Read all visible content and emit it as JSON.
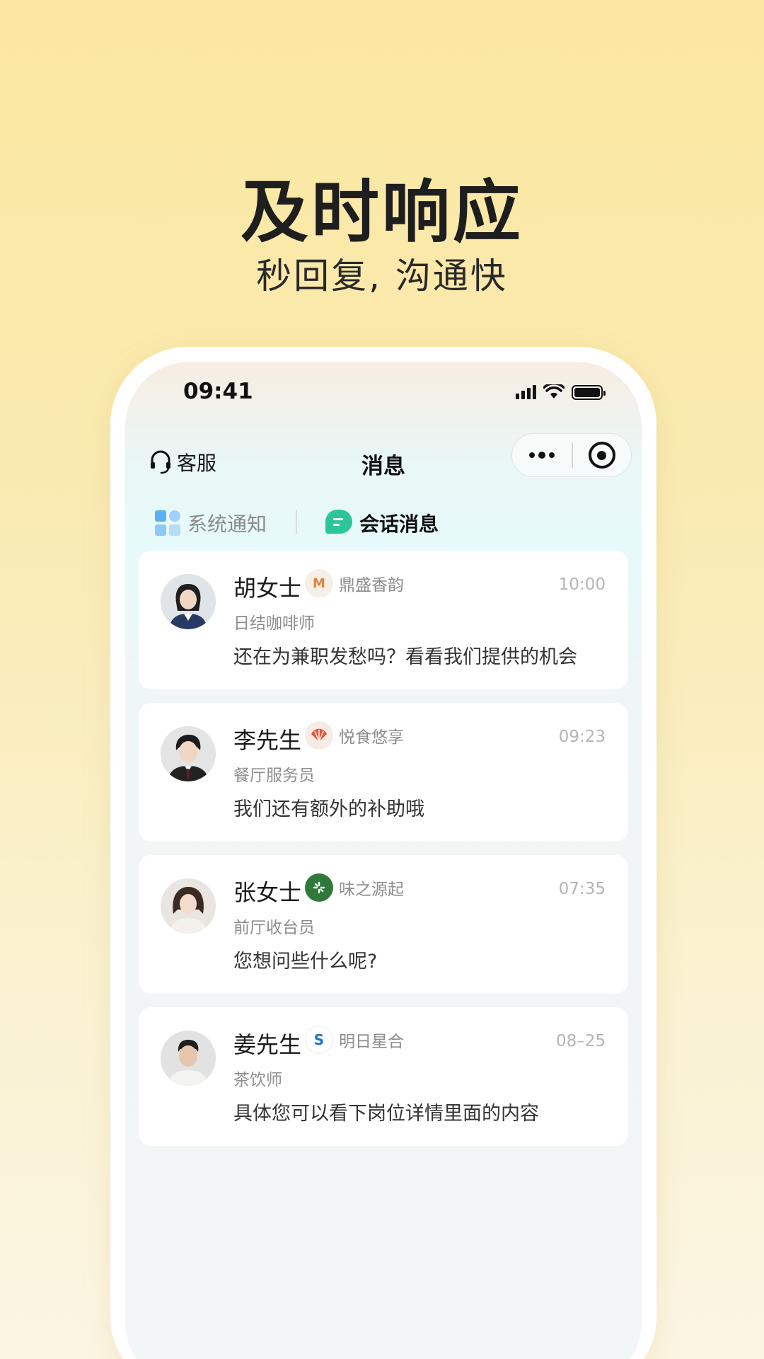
{
  "hero": {
    "title": "及时响应",
    "subtitle": "秒回复, 沟通快"
  },
  "status_bar": {
    "time": "09:41"
  },
  "navbar": {
    "customer_service": "客服",
    "title": "消息"
  },
  "tabs": [
    {
      "label": "系统通知",
      "active": false,
      "icon": "grid-icon"
    },
    {
      "label": "会话消息",
      "active": true,
      "icon": "chat-bubble-icon"
    }
  ],
  "conversations": [
    {
      "name": "胡女士",
      "brand": "鼎盛香韵",
      "brand_icon": "M",
      "time": "10:00",
      "role": "日结咖啡师",
      "message": "还在为兼职发愁吗？看看我们提供的机会"
    },
    {
      "name": "李先生",
      "brand": "悦食悠享",
      "brand_icon": "shell-icon",
      "time": "09:23",
      "role": "餐厅服务员",
      "message": "我们还有额外的补助哦"
    },
    {
      "name": "张女士",
      "brand": "味之源起",
      "brand_icon": "leaf-icon",
      "time": "07:35",
      "role": "前厅收台员",
      "message": "您想问些什么呢?"
    },
    {
      "name": "姜先生",
      "brand": "明日星合",
      "brand_icon": "S",
      "time": "08–25",
      "role": "茶饮师",
      "message": "具体您可以看下岗位详情里面的内容"
    }
  ],
  "colors": {
    "accent_green": "#2cc69a",
    "accent_blue": "#5ab0f0",
    "background_top": "#fbe7a0"
  }
}
